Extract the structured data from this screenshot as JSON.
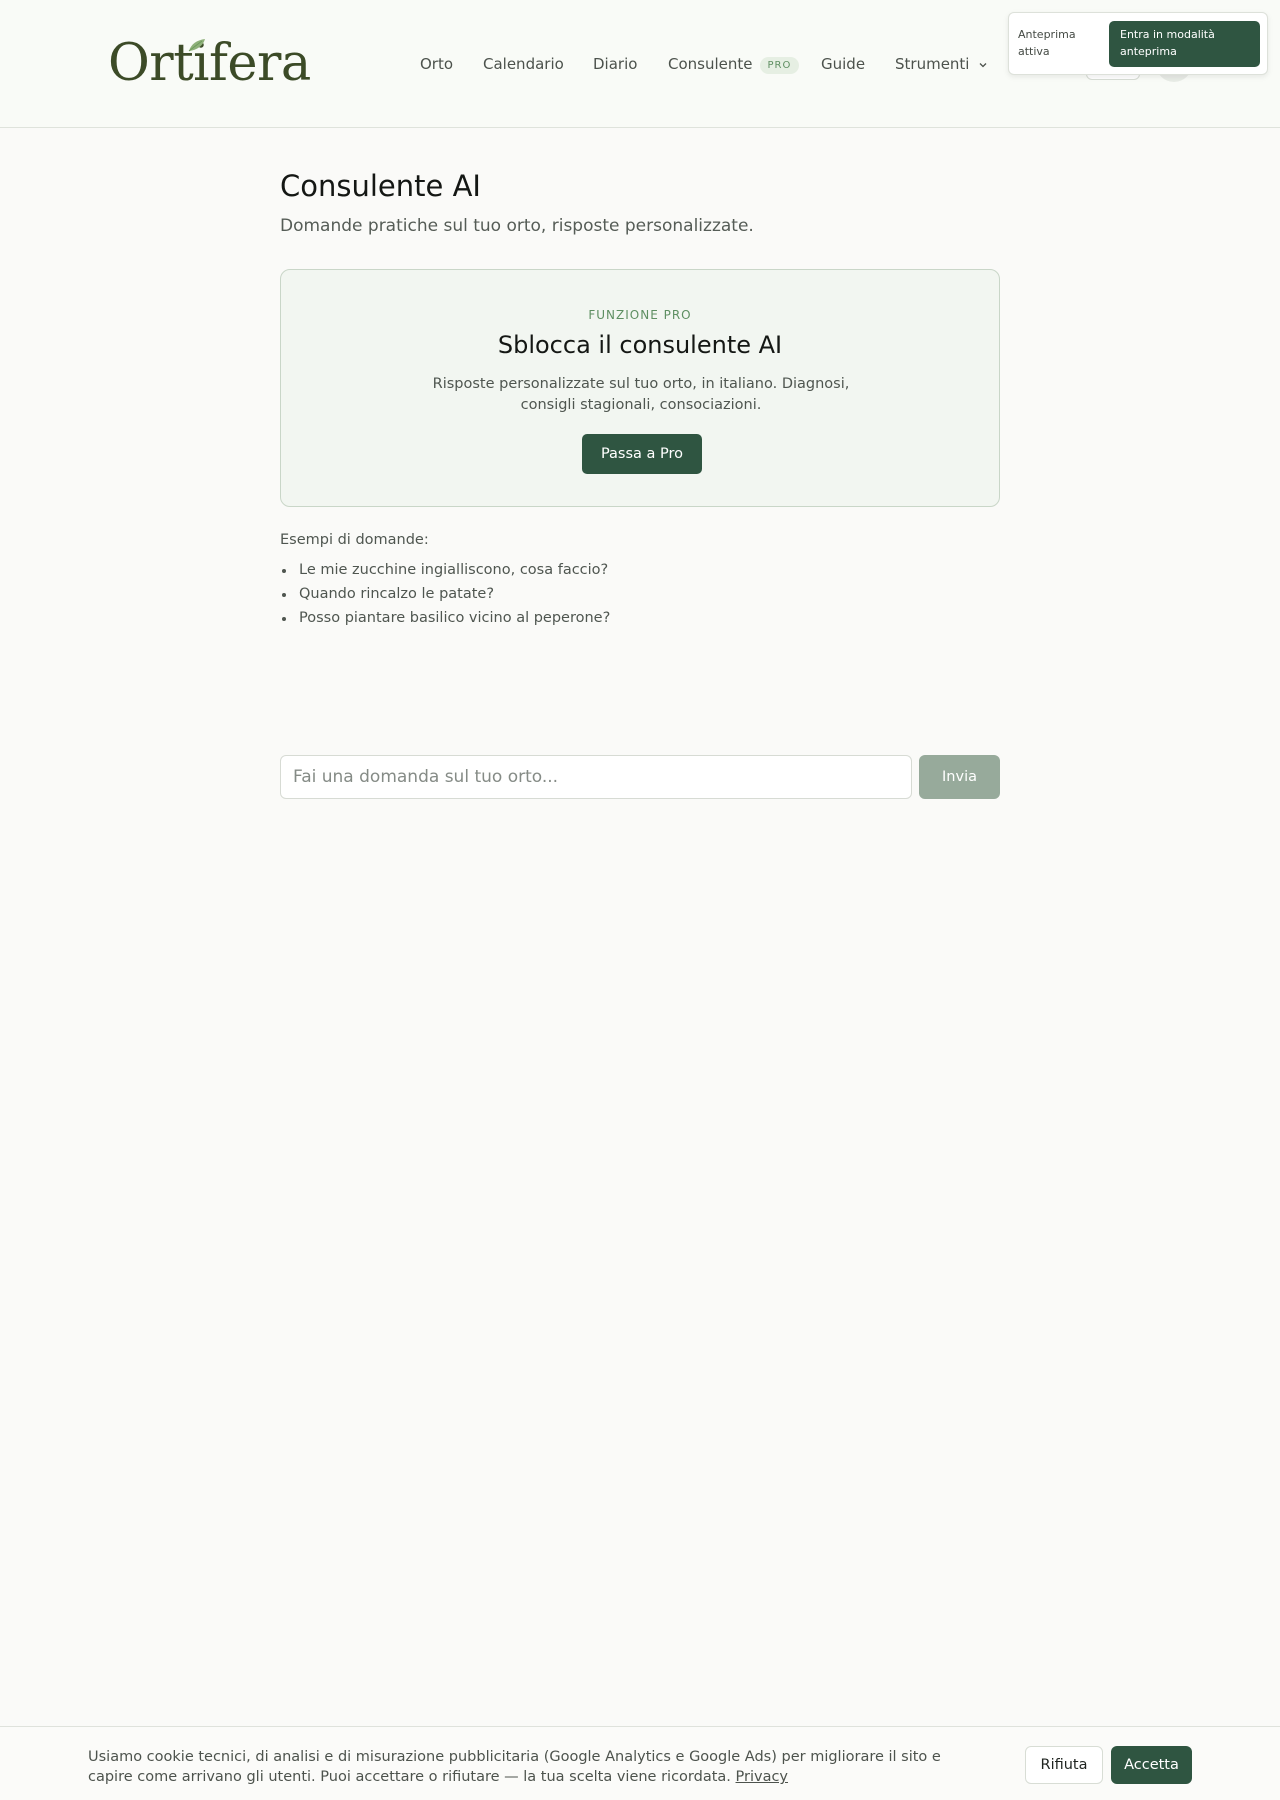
{
  "brand": {
    "logo_text": "Ortifera",
    "accent_color": "#2f5541",
    "logo_color": "#3c4b27"
  },
  "nav": {
    "items": [
      {
        "label": "Orto"
      },
      {
        "label": "Calendario"
      },
      {
        "label": "Diario"
      },
      {
        "label": "Consulente",
        "badge": "PRO"
      },
      {
        "label": "Guide"
      },
      {
        "label": "Strumenti",
        "icon": "chevron-down-icon"
      }
    ]
  },
  "preview": {
    "label": "Anteprima attiva",
    "button_label": "Entra in modalità anteprima"
  },
  "page": {
    "title": "Consulente AI",
    "subtitle": "Domande pratiche sul tuo orto, risposte personalizzate."
  },
  "pro_card": {
    "eyebrow": "FUNZIONE PRO",
    "title": "Sblocca il consulente AI",
    "description": "Risposte personalizzate sul tuo orto, in italiano. Diagnosi, consigli stagionali, consociazioni.",
    "button_label": "Passa a Pro"
  },
  "examples": {
    "label": "Esempi di domande:",
    "items": [
      "Le mie zucchine ingialliscono, cosa faccio?",
      "Quando rincalzo le patate?",
      "Posso piantare basilico vicino al peperone?"
    ]
  },
  "ask": {
    "placeholder": "Fai una domanda sul tuo orto...",
    "value": "",
    "button_label": "Invia"
  },
  "cookie": {
    "text": "Usiamo cookie tecnici, di analisi e di misurazione pubblicitaria (Google Analytics e Google Ads) per migliorare il sito e capire come arrivano gli utenti. Puoi accettare o rifiutare — la tua scelta viene ricordata.",
    "link_label": "Privacy",
    "reject_label": "Rifiuta",
    "accept_label": "Accetta"
  }
}
